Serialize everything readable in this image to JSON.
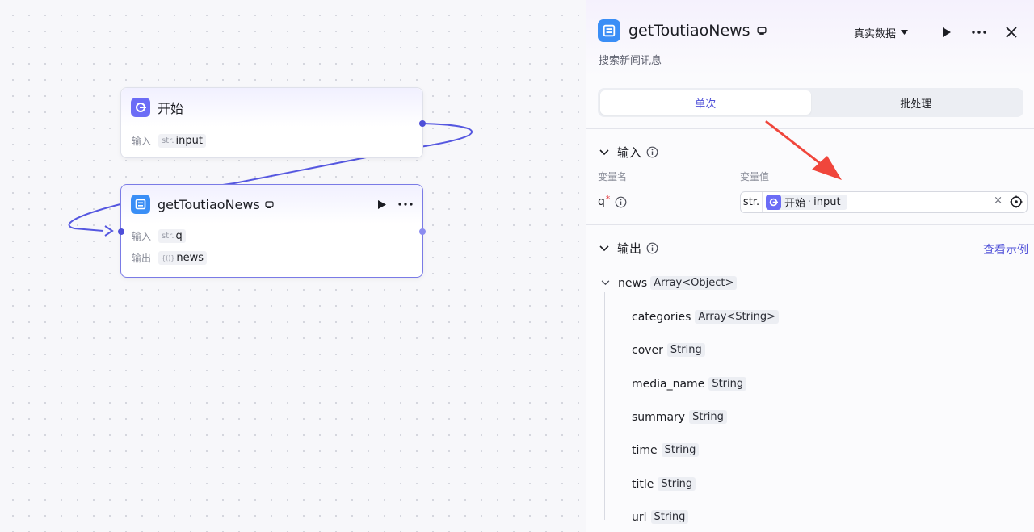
{
  "canvas": {
    "start_node": {
      "title": "开始",
      "rows": [
        {
          "label": "输入",
          "type_prefix": "str.",
          "value": "input"
        }
      ]
    },
    "news_node": {
      "title": "getToutiaoNews",
      "rows": [
        {
          "label": "输入",
          "type_prefix": "str.",
          "value": "q"
        },
        {
          "label": "输出",
          "type_prefix": "{()}",
          "value": "news"
        }
      ]
    }
  },
  "panel": {
    "title": "getToutiaoNews",
    "description": "搜索新闻讯息",
    "mode_label": "真实数据",
    "tabs": [
      {
        "label": "单次",
        "active": true
      },
      {
        "label": "批处理",
        "active": false
      }
    ],
    "input_section": {
      "title": "输入",
      "col_name": "变量名",
      "col_value": "变量值",
      "var_name": "q",
      "required_mark": "*",
      "value_type": "str.",
      "ref_node": "开始",
      "ref_sep": "·",
      "ref_var": "input",
      "clear": "×"
    },
    "output_section": {
      "title": "输出",
      "example_link": "查看示例",
      "root": {
        "name": "news",
        "type": "Array<Object>"
      },
      "children": [
        {
          "name": "categories",
          "type": "Array<String>"
        },
        {
          "name": "cover",
          "type": "String"
        },
        {
          "name": "media_name",
          "type": "String"
        },
        {
          "name": "summary",
          "type": "String"
        },
        {
          "name": "time",
          "type": "String"
        },
        {
          "name": "title",
          "type": "String"
        },
        {
          "name": "url",
          "type": "String"
        }
      ]
    }
  },
  "colors": {
    "accent": "#4e4fd8",
    "start_icon": "#6b6cf6",
    "plugin_icon": "#3a8ef6",
    "annotation": "#f0463c"
  }
}
